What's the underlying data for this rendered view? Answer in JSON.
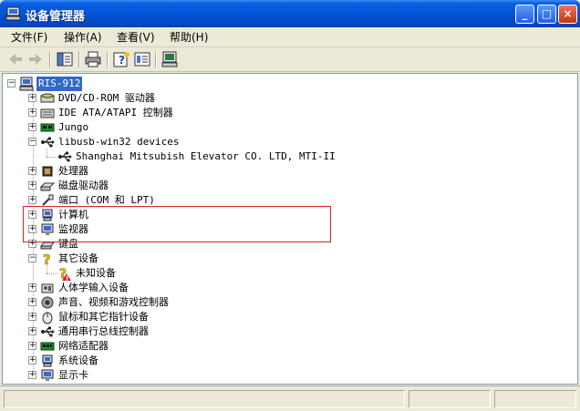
{
  "window": {
    "title": "设备管理器",
    "title_icon": "computer-management-icon",
    "minimize": "_",
    "maximize": "□",
    "close": "×"
  },
  "menu": [
    {
      "label": "文件(F)"
    },
    {
      "label": "操作(A)"
    },
    {
      "label": "查看(V)"
    },
    {
      "label": "帮助(H)"
    }
  ],
  "toolbar": {
    "icons": [
      "back-arrow-icon",
      "forward-arrow-icon",
      "show-hide-tree-icon",
      "print-icon",
      "help-icon",
      "properties-icon",
      "scan-hardware-icon"
    ]
  },
  "tree": {
    "root": "RIS-912",
    "items": [
      {
        "label": "DVD/CD-ROM 驱动器",
        "expander": "+",
        "icon": "dvd-drive-icon"
      },
      {
        "label": "IDE ATA/ATAPI 控制器",
        "expander": "+",
        "icon": "ide-controller-icon"
      },
      {
        "label": "Jungo",
        "expander": "+",
        "icon": "jungo-board-icon"
      },
      {
        "label": "libusb-win32 devices",
        "expander": "-",
        "icon": "usb-icon"
      },
      {
        "label": "Shanghai Mitsubish Elevator CO. LTD, MTI-II",
        "expander": "",
        "icon": "usb-icon"
      },
      {
        "label": "处理器",
        "expander": "+",
        "icon": "processor-icon"
      },
      {
        "label": "磁盘驱动器",
        "expander": "+",
        "icon": "disk-drive-icon"
      },
      {
        "label": "端口 (COM 和 LPT)",
        "expander": "+",
        "icon": "port-icon"
      },
      {
        "label": "计算机",
        "expander": "+",
        "icon": "computer-icon"
      },
      {
        "label": "监视器",
        "expander": "+",
        "icon": "monitor-icon"
      },
      {
        "label": "键盘",
        "expander": "+",
        "icon": "keyboard-icon"
      },
      {
        "label": "其它设备",
        "expander": "-",
        "icon": "unknown-device-icon"
      },
      {
        "label": "未知设备",
        "expander": "",
        "icon": "unknown-device-warning-icon"
      },
      {
        "label": "人体学输入设备",
        "expander": "+",
        "icon": "hid-icon"
      },
      {
        "label": "声音、视频和游戏控制器",
        "expander": "+",
        "icon": "sound-icon"
      },
      {
        "label": "鼠标和其它指针设备",
        "expander": "+",
        "icon": "mouse-icon"
      },
      {
        "label": "通用串行总线控制器",
        "expander": "+",
        "icon": "usb-controller-icon"
      },
      {
        "label": "网络适配器",
        "expander": "+",
        "icon": "network-adapter-icon"
      },
      {
        "label": "系统设备",
        "expander": "+",
        "icon": "system-device-icon"
      },
      {
        "label": "显示卡",
        "expander": "+",
        "icon": "display-adapter-icon"
      }
    ]
  },
  "colors": {
    "titlebar": "#0454d6",
    "selection": "#316ac5",
    "highlight_box": "#dd2222"
  }
}
